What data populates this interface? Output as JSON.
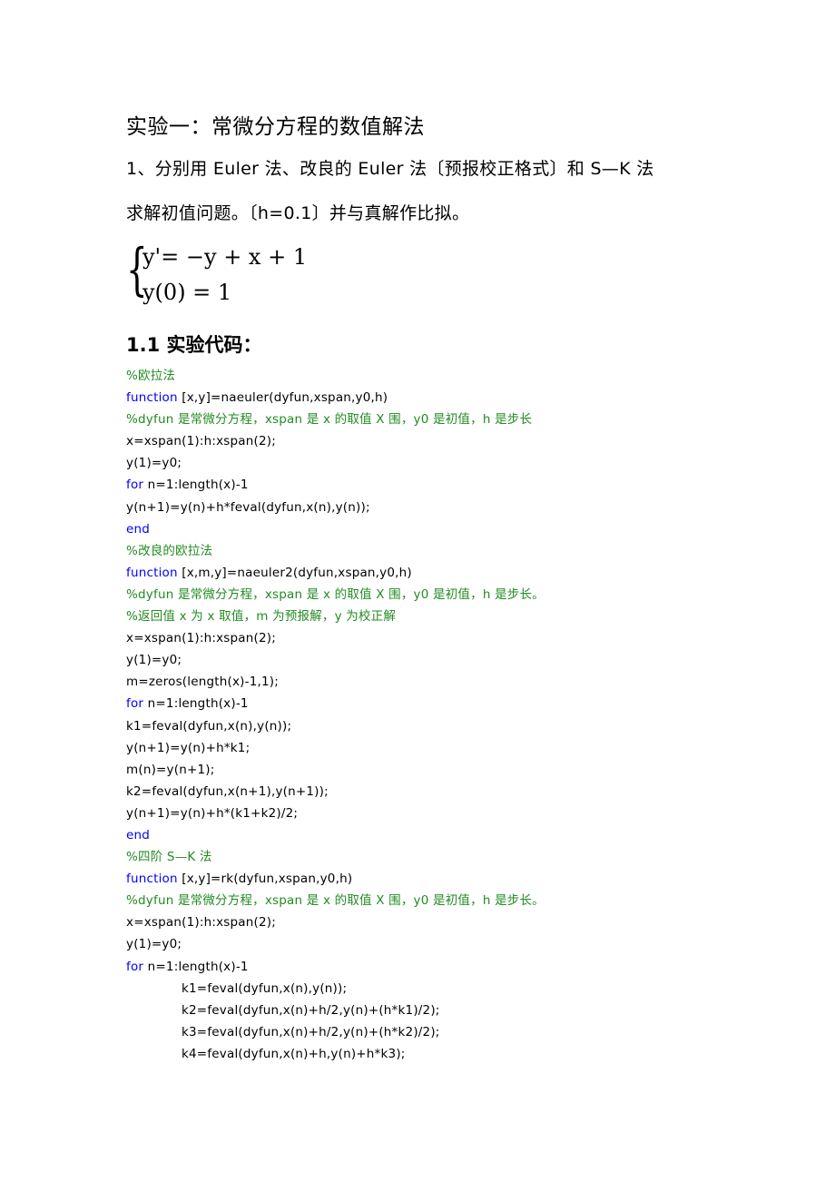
{
  "document": {
    "title": "实验一：常微分方程的数值解法",
    "problem_line1": "1、分别用 Euler 法、改良的 Euler 法〔预报校正格式〕和 S—K 法",
    "problem_line2": "求解初值问题。〔h=0.1〕并与真解作比拟。",
    "equation": {
      "line1": "y'= −y + x + 1",
      "line2": "y(0) = 1"
    },
    "section_heading": "1.1 实验代码："
  },
  "colors": {
    "comment": "#228B22",
    "keyword": "#0000FF",
    "text": "#000000"
  },
  "code": {
    "lines": [
      {
        "type": "comment",
        "text": "%欧拉法"
      },
      {
        "type": "kw",
        "kw": "function",
        "rest": " [x,y]=naeuler(dyfun,xspan,y0,h)"
      },
      {
        "type": "comment",
        "text": "%dyfun 是常微分方程，xspan 是 x 的取值 X 围，y0 是初值，h 是步长"
      },
      {
        "type": "plain",
        "text": "x=xspan(1):h:xspan(2);"
      },
      {
        "type": "plain",
        "text": "y(1)=y0;"
      },
      {
        "type": "kw",
        "kw": "for",
        "rest": " n=1:length(x)-1"
      },
      {
        "type": "plain",
        "text": "y(n+1)=y(n)+h*feval(dyfun,x(n),y(n));"
      },
      {
        "type": "kwonly",
        "text": "end"
      },
      {
        "type": "comment",
        "text": "%改良的欧拉法"
      },
      {
        "type": "kw",
        "kw": "function",
        "rest": " [x,m,y]=naeuler2(dyfun,xspan,y0,h)"
      },
      {
        "type": "comment",
        "text": "%dyfun 是常微分方程，xspan 是 x 的取值 X 围，y0 是初值，h 是步长。"
      },
      {
        "type": "comment",
        "text": "%返回值 x 为 x 取值，m 为预报解，y 为校正解"
      },
      {
        "type": "plain",
        "text": "x=xspan(1):h:xspan(2);"
      },
      {
        "type": "plain",
        "text": "y(1)=y0;"
      },
      {
        "type": "plain",
        "text": "m=zeros(length(x)-1,1);"
      },
      {
        "type": "kw",
        "kw": "for",
        "rest": " n=1:length(x)-1"
      },
      {
        "type": "plain",
        "text": "k1=feval(dyfun,x(n),y(n));"
      },
      {
        "type": "plain",
        "text": "y(n+1)=y(n)+h*k1;"
      },
      {
        "type": "plain",
        "text": "m(n)=y(n+1);"
      },
      {
        "type": "plain",
        "text": "k2=feval(dyfun,x(n+1),y(n+1));"
      },
      {
        "type": "plain",
        "text": "y(n+1)=y(n)+h*(k1+k2)/2;"
      },
      {
        "type": "kwonly",
        "text": "end"
      },
      {
        "type": "comment",
        "text": "%四阶 S—K 法"
      },
      {
        "type": "kw",
        "kw": "function",
        "rest": " [x,y]=rk(dyfun,xspan,y0,h)"
      },
      {
        "type": "comment",
        "text": "%dyfun 是常微分方程，xspan 是 x 的取值 X 围，y0 是初值，h 是步长。"
      },
      {
        "type": "plain",
        "text": "x=xspan(1):h:xspan(2);"
      },
      {
        "type": "plain",
        "text": "y(1)=y0;"
      },
      {
        "type": "kw",
        "kw": "for",
        "rest": " n=1:length(x)-1"
      },
      {
        "type": "indent",
        "text": "k1=feval(dyfun,x(n),y(n));"
      },
      {
        "type": "indent",
        "text": "k2=feval(dyfun,x(n)+h/2,y(n)+(h*k1)/2);"
      },
      {
        "type": "indent",
        "text": "k3=feval(dyfun,x(n)+h/2,y(n)+(h*k2)/2);"
      },
      {
        "type": "indent",
        "text": "k4=feval(dyfun,x(n)+h,y(n)+h*k3);"
      }
    ]
  }
}
